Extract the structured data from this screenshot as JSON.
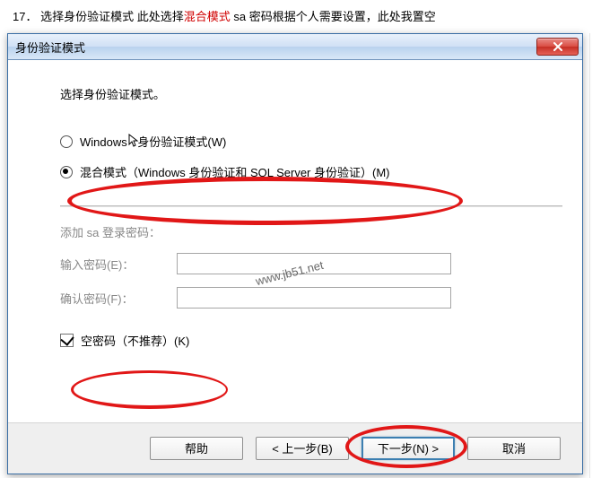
{
  "caption": {
    "num": "17．",
    "pre": "选择身份验证模式 此处选择",
    "red": "混合模式",
    "post": "   sa 密码根据个人需要设置，此处我置空"
  },
  "window": {
    "title": "身份验证模式",
    "close_icon": "close-icon"
  },
  "watermark": "www.jb51.net",
  "form": {
    "heading": "选择身份验证模式。",
    "radio_windows": "Windows 身份验证模式(W)",
    "radio_mixed": "混合模式（Windows 身份验证和 SQL Server 身份验证）(M)",
    "add_pw_label": "添加 sa 登录密码：",
    "enter_pw": "输入密码(E)：",
    "confirm_pw": "确认密码(F)：",
    "pw_value": "",
    "empty_pw": "空密码（不推荐）(K)"
  },
  "buttons": {
    "help": "帮助",
    "back": "< 上一步(B)",
    "next": "下一步(N) >",
    "cancel": "取消"
  }
}
